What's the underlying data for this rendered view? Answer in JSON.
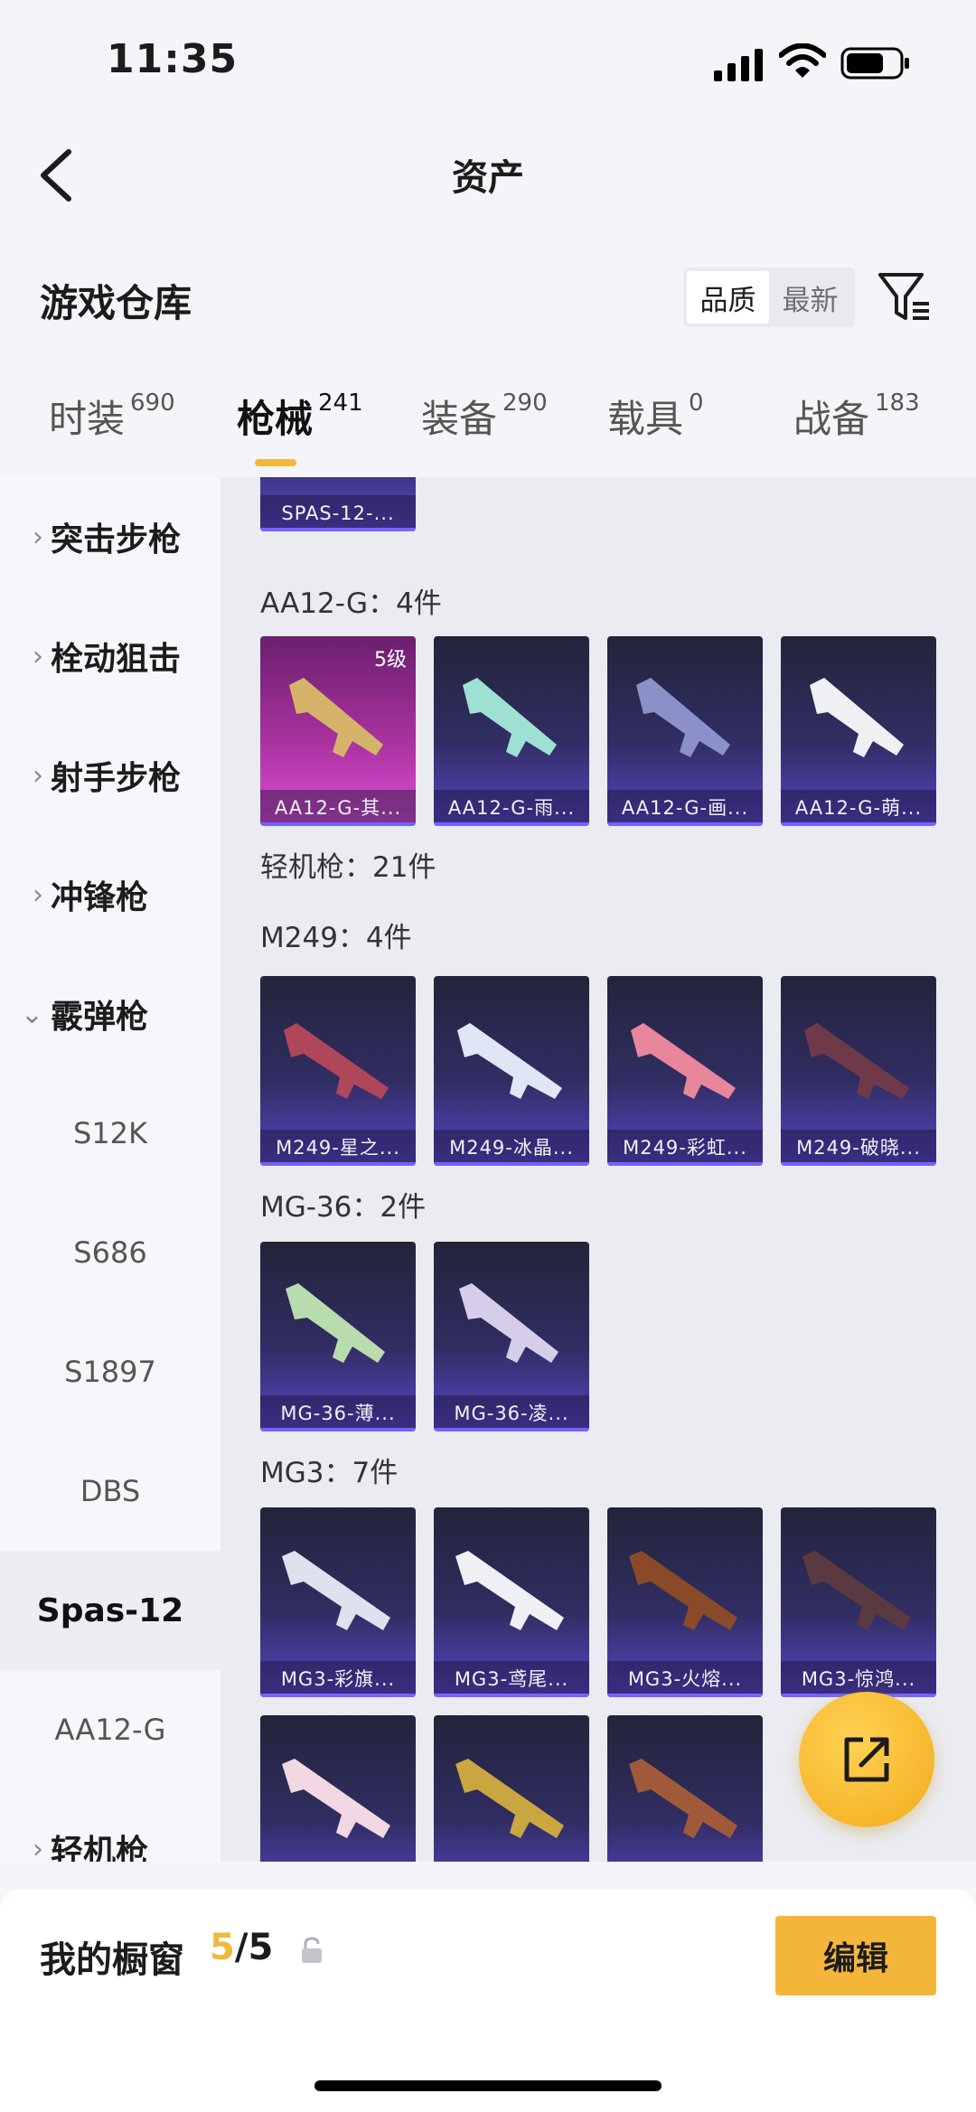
{
  "status_bar": {
    "time": "11:35"
  },
  "nav": {
    "title": "资产"
  },
  "warehouse": {
    "title": "游戏仓库",
    "sort_options": [
      "品质",
      "最新"
    ],
    "active_sort": "品质"
  },
  "category_tabs": [
    {
      "label": "时装",
      "count": "690"
    },
    {
      "label": "枪械",
      "count": "241",
      "active": true
    },
    {
      "label": "装备",
      "count": "290"
    },
    {
      "label": "载具",
      "count": "0"
    },
    {
      "label": "战备",
      "count": "183"
    }
  ],
  "sidebar": {
    "categories": [
      "突击步枪",
      "栓动狙击",
      "射手步枪",
      "冲锋枪",
      "霰弹枪",
      "轻机枪"
    ],
    "sub_items": [
      "S12K",
      "S686",
      "S1897",
      "DBS",
      "Spas-12",
      "AA12-G"
    ],
    "active_sub": "Spas-12"
  },
  "content": {
    "top_partial_card": "SPAS-12-...",
    "groups": {
      "aa12": {
        "title": "AA12-G：4件",
        "cards": [
          "AA12-G-其...",
          "AA12-G-雨...",
          "AA12-G-画...",
          "AA12-G-萌..."
        ],
        "level": "5级"
      },
      "lmg_header": "轻机枪：21件",
      "m249": {
        "title": "M249：4件",
        "cards": [
          "M249-星之...",
          "M249-冰晶...",
          "M249-彩虹...",
          "M249-破晓..."
        ]
      },
      "mg36": {
        "title": "MG-36：2件",
        "cards": [
          "MG-36-薄...",
          "MG-36-凌..."
        ]
      },
      "mg3": {
        "title": "MG3：7件",
        "cards": [
          "MG3-彩旗...",
          "MG3-鸢尾...",
          "MG3-火熔...",
          "MG3-惊鸿..."
        ]
      }
    }
  },
  "bottom_bar": {
    "showcase_label": "我的橱窗",
    "showcase_current": "5",
    "showcase_total": "/5",
    "edit_label": "编辑"
  },
  "colors": {
    "accent": "#f2b83a",
    "card_border": "#7563ff",
    "legend_card": "#a8329e"
  }
}
